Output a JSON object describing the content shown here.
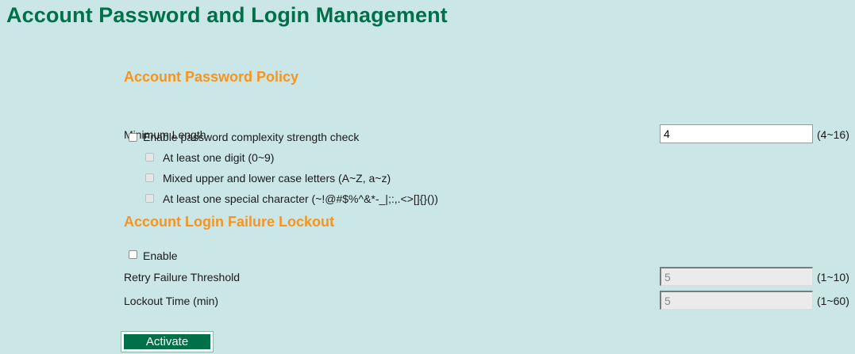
{
  "page": {
    "title": "Account Password and Login Management"
  },
  "password_policy": {
    "heading": "Account Password Policy",
    "min_length_label": "Minimum Length",
    "min_length_value": "4",
    "min_length_range": "(4~16)",
    "complexity_check": {
      "label": "Enable password complexity strength check",
      "checked": false
    },
    "digit": {
      "label": "At least one digit (0~9)",
      "checked": false,
      "disabled": true
    },
    "mixed_case": {
      "label": "Mixed upper and lower case letters (A~Z, a~z)",
      "checked": false,
      "disabled": true
    },
    "special_char": {
      "label": "At least one special character (~!@#$%^&*-_|;:,.<>[]{}())",
      "checked": false,
      "disabled": true
    }
  },
  "lockout": {
    "heading": "Account Login Failure Lockout",
    "enable": {
      "label": "Enable",
      "checked": false
    },
    "retry_label": "Retry Failure Threshold",
    "retry_value": "5",
    "retry_range": "(1~10)",
    "lockout_time_label": "Lockout Time (min)",
    "lockout_time_value": "5",
    "lockout_time_range": "(1~60)"
  },
  "actions": {
    "activate_label": "Activate"
  },
  "colors": {
    "background": "#cbe6e6",
    "title": "#00704a",
    "section_heading": "#f7941d",
    "button": "#00704a"
  }
}
